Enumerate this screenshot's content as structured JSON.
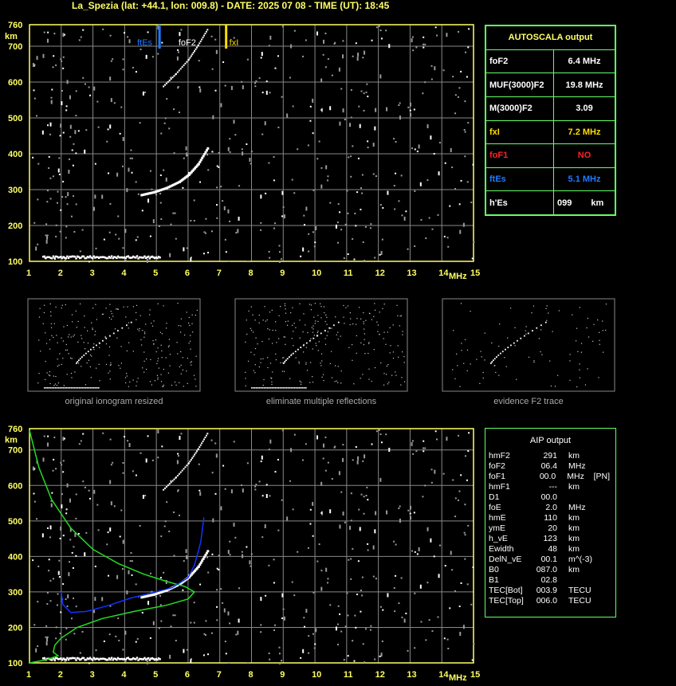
{
  "header": {
    "title": "La_Spezia (lat: +44.1, lon: 009.8) - DATE: 2025 07 08 - TIME (UT): 18:45"
  },
  "colors": {
    "axis": "#ffff66",
    "grid": "#888888",
    "panel_border": "#66ff66",
    "fbEs": "#1e7bff",
    "fxI": "#ffdd00",
    "green_curve": "#22dd22",
    "blue_curve": "#1133ff",
    "red": "#ff2222"
  },
  "chart_data": [
    {
      "type": "scatter",
      "id": "ionogram-top",
      "x_ticks": [
        "1",
        "2",
        "3",
        "4",
        "5",
        "6",
        "7",
        "8",
        "9",
        "10",
        "11",
        "12",
        "13",
        "14",
        "15"
      ],
      "y_ticks": [
        "100",
        "200",
        "300",
        "400",
        "500",
        "600",
        "700",
        "760"
      ],
      "xlabel": "MHz",
      "ylabel": "km",
      "xlim": [
        1,
        15
      ],
      "ylim": [
        100,
        760
      ],
      "grid": true,
      "markers": [
        {
          "label": "ftEs",
          "freq": 5.1,
          "color": "#1e7bff"
        },
        {
          "label": "foF2",
          "freq": 6.4,
          "color": "#ffffff"
        },
        {
          "label": "fxI",
          "freq": 7.2,
          "color": "#ffdd00"
        }
      ],
      "traces": {
        "es_layer": {
          "x": [
            1.4,
            5.1
          ],
          "y": 115
        },
        "f2_trace": [
          [
            4.5,
            288
          ],
          [
            4.9,
            296
          ],
          [
            5.3,
            308
          ],
          [
            5.7,
            325
          ],
          [
            6.0,
            345
          ],
          [
            6.3,
            375
          ],
          [
            6.6,
            420
          ]
        ],
        "f2_second_hop": [
          [
            5.2,
            590
          ],
          [
            5.6,
            625
          ],
          [
            6.0,
            665
          ],
          [
            6.3,
            705
          ],
          [
            6.6,
            750
          ]
        ]
      }
    },
    {
      "type": "scatter",
      "id": "ionogram-bottom",
      "x_ticks": [
        "1",
        "2",
        "3",
        "4",
        "5",
        "6",
        "7",
        "8",
        "9",
        "10",
        "11",
        "12",
        "13",
        "14",
        "15"
      ],
      "y_ticks": [
        "100",
        "200",
        "300",
        "400",
        "500",
        "600",
        "700",
        "760"
      ],
      "xlabel": "MHz",
      "ylabel": "km",
      "xlim": [
        1,
        15
      ],
      "ylim": [
        100,
        760
      ],
      "grid": true,
      "curves": {
        "green": [
          [
            1.0,
            755
          ],
          [
            1.3,
            650
          ],
          [
            1.7,
            560
          ],
          [
            2.3,
            480
          ],
          [
            3.0,
            420
          ],
          [
            3.8,
            380
          ],
          [
            4.6,
            350
          ],
          [
            5.3,
            330
          ],
          [
            5.9,
            315
          ],
          [
            6.2,
            300
          ],
          [
            6.0,
            280
          ],
          [
            5.3,
            262
          ],
          [
            4.3,
            245
          ],
          [
            3.3,
            225
          ],
          [
            2.5,
            200
          ],
          [
            2.0,
            170
          ],
          [
            1.8,
            150
          ],
          [
            1.75,
            130
          ],
          [
            1.9,
            120
          ],
          [
            1.5,
            108
          ],
          [
            1.0,
            100
          ]
        ],
        "blue": [
          [
            2.0,
            300
          ],
          [
            2.05,
            265
          ],
          [
            2.3,
            242
          ],
          [
            2.8,
            245
          ],
          [
            3.5,
            262
          ],
          [
            4.2,
            283
          ],
          [
            4.9,
            298
          ],
          [
            5.5,
            312
          ],
          [
            6.0,
            340
          ],
          [
            6.2,
            375
          ],
          [
            6.4,
            440
          ],
          [
            6.5,
            510
          ]
        ]
      }
    }
  ],
  "autoscala": {
    "title": "AUTOSCALA output",
    "rows": [
      {
        "label": "foF2",
        "value": "6.4 MHz",
        "color": "#ffffff"
      },
      {
        "label": "MUF(3000)F2",
        "value": "19.8 MHz",
        "color": "#ffffff"
      },
      {
        "label": "M(3000)F2",
        "value": "3.09",
        "color": "#ffffff"
      },
      {
        "label": "fxI",
        "value": "7.2 MHz",
        "color": "#ffdd00"
      },
      {
        "label": "foF1",
        "value": "NO",
        "color": "#ff2222"
      },
      {
        "label": "ftEs",
        "value": "5.1 MHz",
        "color": "#1e7bff"
      },
      {
        "label": "h'Es",
        "value": "099",
        "unit": "km",
        "color": "#ffffff"
      }
    ]
  },
  "thumbnails": [
    {
      "caption": "original ionogram resized"
    },
    {
      "caption": "eliminate multiple reflections"
    },
    {
      "caption": "evidence F2 trace"
    }
  ],
  "aip": {
    "title": "AIP output",
    "rows": [
      {
        "name": "hmF2",
        "value": "291",
        "unit": "km"
      },
      {
        "name": "foF2",
        "value": "06.4",
        "unit": "MHz"
      },
      {
        "name": "foF1",
        "value": "00.0",
        "unit": "MHz",
        "extra": "[PN]"
      },
      {
        "name": "hmF1",
        "value": "---",
        "unit": "km"
      },
      {
        "name": "D1",
        "value": "00.0",
        "unit": ""
      },
      {
        "name": "foE",
        "value": "2.0",
        "unit": "MHz"
      },
      {
        "name": "hmE",
        "value": "110",
        "unit": "km"
      },
      {
        "name": "ymE",
        "value": "20",
        "unit": "km"
      },
      {
        "name": "h_vE",
        "value": "123",
        "unit": "km"
      },
      {
        "name": "Ewidth",
        "value": "48",
        "unit": "km"
      },
      {
        "name": "DelN_vE",
        "value": "00.1",
        "unit": "m^(-3)"
      },
      {
        "name": "B0",
        "value": "087.0",
        "unit": "km"
      },
      {
        "name": "B1",
        "value": "02.8",
        "unit": ""
      },
      {
        "name": "TEC[Bot]",
        "value": "003.9",
        "unit": "TECU"
      },
      {
        "name": "TEC[Top]",
        "value": "006.0",
        "unit": "TECU"
      }
    ]
  }
}
